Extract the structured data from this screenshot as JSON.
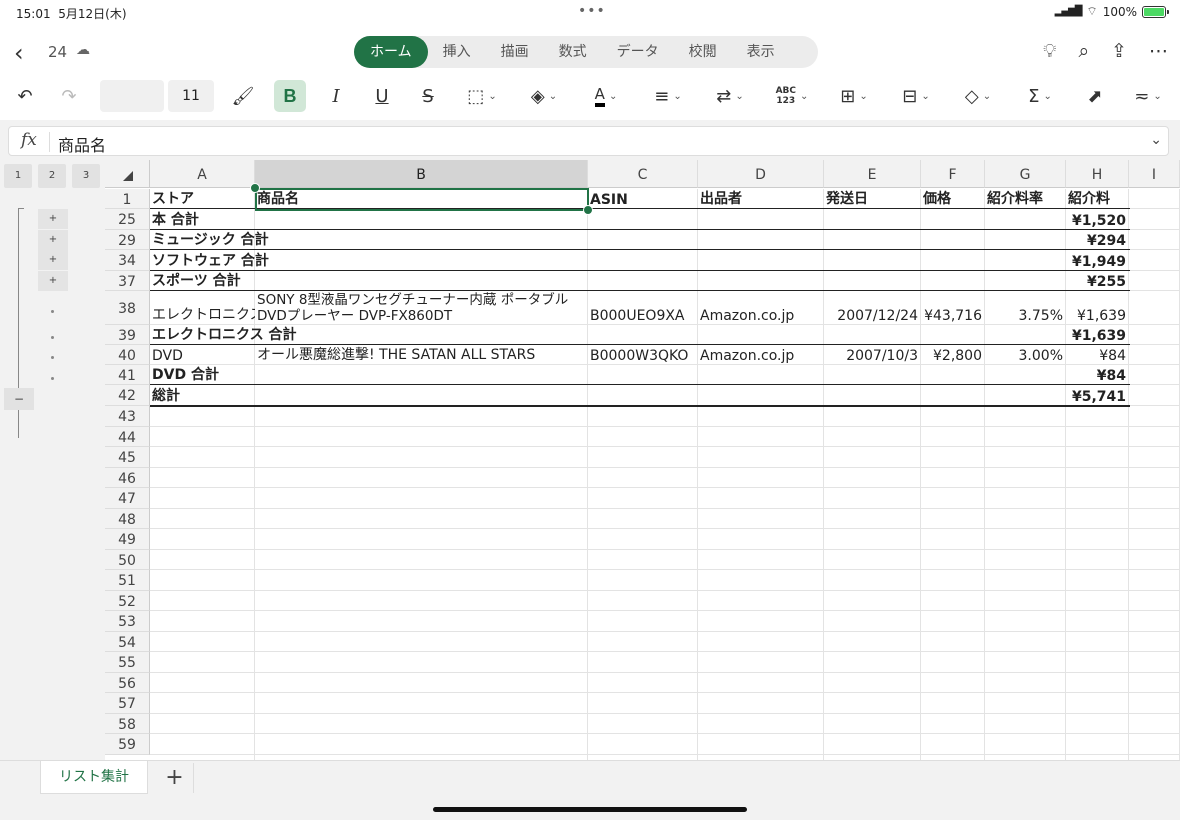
{
  "status": {
    "time": "15:01",
    "date": "5月12日(木)",
    "battery": "100%"
  },
  "title": {
    "doc_number": "24"
  },
  "tabs": [
    "ホーム",
    "挿入",
    "描画",
    "数式",
    "データ",
    "校閲",
    "表示"
  ],
  "toolbar": {
    "font_name": "",
    "font_size": "11",
    "number_format_label": "ABC\n123"
  },
  "formula": {
    "fx": "fx",
    "value": "商品名"
  },
  "outline": {
    "levels": [
      "1",
      "2",
      "3"
    ],
    "plus": "+",
    "minus": "−"
  },
  "columns": [
    "A",
    "B",
    "C",
    "D",
    "E",
    "F",
    "G",
    "H",
    "I"
  ],
  "header_row": {
    "num": "1",
    "cells": [
      "ストア",
      "商品名",
      "ASIN",
      "出品者",
      "発送日",
      "価格",
      "紹介料率",
      "紹介料"
    ]
  },
  "rows": [
    {
      "num": "25",
      "A": "本 合計",
      "H": "¥1,520",
      "bold": true
    },
    {
      "num": "29",
      "A": "ミュージック 合計",
      "H": "¥294",
      "bold": true
    },
    {
      "num": "34",
      "A": "ソフトウェア 合計",
      "H": "¥1,949",
      "bold": true
    },
    {
      "num": "37",
      "A": "スポーツ 合計",
      "H": "¥255",
      "bold": true
    },
    {
      "num": "38",
      "A": "エレクトロニクス",
      "B": "SONY 8型液晶ワンセグチューナー内蔵 ポータブルDVDプレーヤー DVP-FX860DT",
      "C": "B000UEO9XA",
      "D": "Amazon.co.jp",
      "E": "2007/12/24",
      "F": "¥43,716",
      "G": "3.75%",
      "H": "¥1,639",
      "bold": false
    },
    {
      "num": "39",
      "A": "エレクトロニクス 合計",
      "H": "¥1,639",
      "bold": true
    },
    {
      "num": "40",
      "A": "DVD",
      "B": "オール悪魔総進撃! THE SATAN ALL STARS",
      "C": "B0000W3QKO",
      "D": "Amazon.co.jp",
      "E": "2007/10/3",
      "F": "¥2,800",
      "G": "3.00%",
      "H": "¥84",
      "bold": false
    },
    {
      "num": "41",
      "A": "DVD 合計",
      "H": "¥84",
      "bold": true
    },
    {
      "num": "42",
      "A": "総計",
      "H": "¥5,741",
      "bold": true
    }
  ],
  "empty_rows": [
    "43",
    "44",
    "45",
    "46",
    "47",
    "48",
    "49",
    "50",
    "51",
    "52",
    "53",
    "54",
    "55",
    "56",
    "57",
    "58",
    "59"
  ],
  "sheets": {
    "active": "リスト集計",
    "add": "+"
  }
}
